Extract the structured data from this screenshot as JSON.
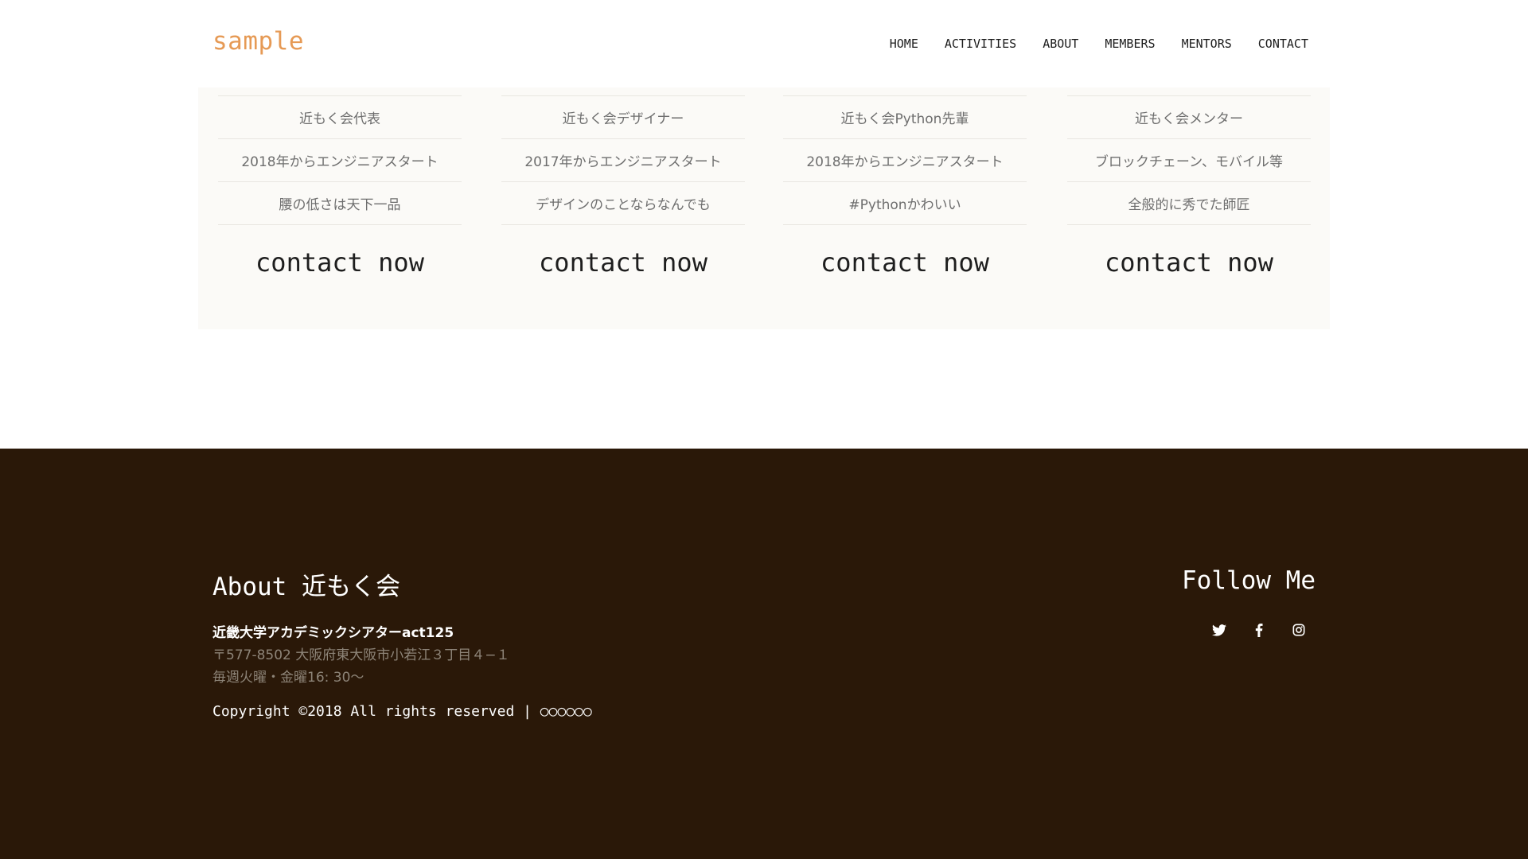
{
  "header": {
    "logo": "sample",
    "nav": [
      "HOME",
      "ACTIVITIES",
      "ABOUT",
      "MEMBERS",
      "MENTORS",
      "CONTACT"
    ]
  },
  "cards": [
    {
      "rows": [
        "近もく会代表",
        "2018年からエンジニアスタート",
        "腰の低さは天下一品"
      ],
      "button": "contact now"
    },
    {
      "rows": [
        "近もく会デザイナー",
        "2017年からエンジニアスタート",
        "デザインのことならなんでも"
      ],
      "button": "contact now"
    },
    {
      "rows": [
        "近もく会Python先輩",
        "2018年からエンジニアスタート",
        "#Pythonかわいい"
      ],
      "button": "contact now"
    },
    {
      "rows": [
        "近もく会メンター",
        "ブロックチェーン、モバイル等",
        "全般的に秀でた師匠"
      ],
      "button": "contact now"
    }
  ],
  "footer": {
    "about_title": "About 近もく会",
    "address_name": "近畿大学アカデミックシアターact125",
    "address": "〒577-8502 大阪府東大阪市小若江３丁目４−１",
    "schedule": "毎週火曜・金曜16: 30〜",
    "copyright": "Copyright ©2018 All rights reserved | ○○○○○○",
    "follow_title": "Follow Me",
    "social_icons": [
      "twitter-icon",
      "facebook-icon",
      "instagram-icon"
    ]
  },
  "colors": {
    "logo": "#e69a55",
    "footer_bg": "#2a1808",
    "card_bg": "#fbfaf7"
  }
}
